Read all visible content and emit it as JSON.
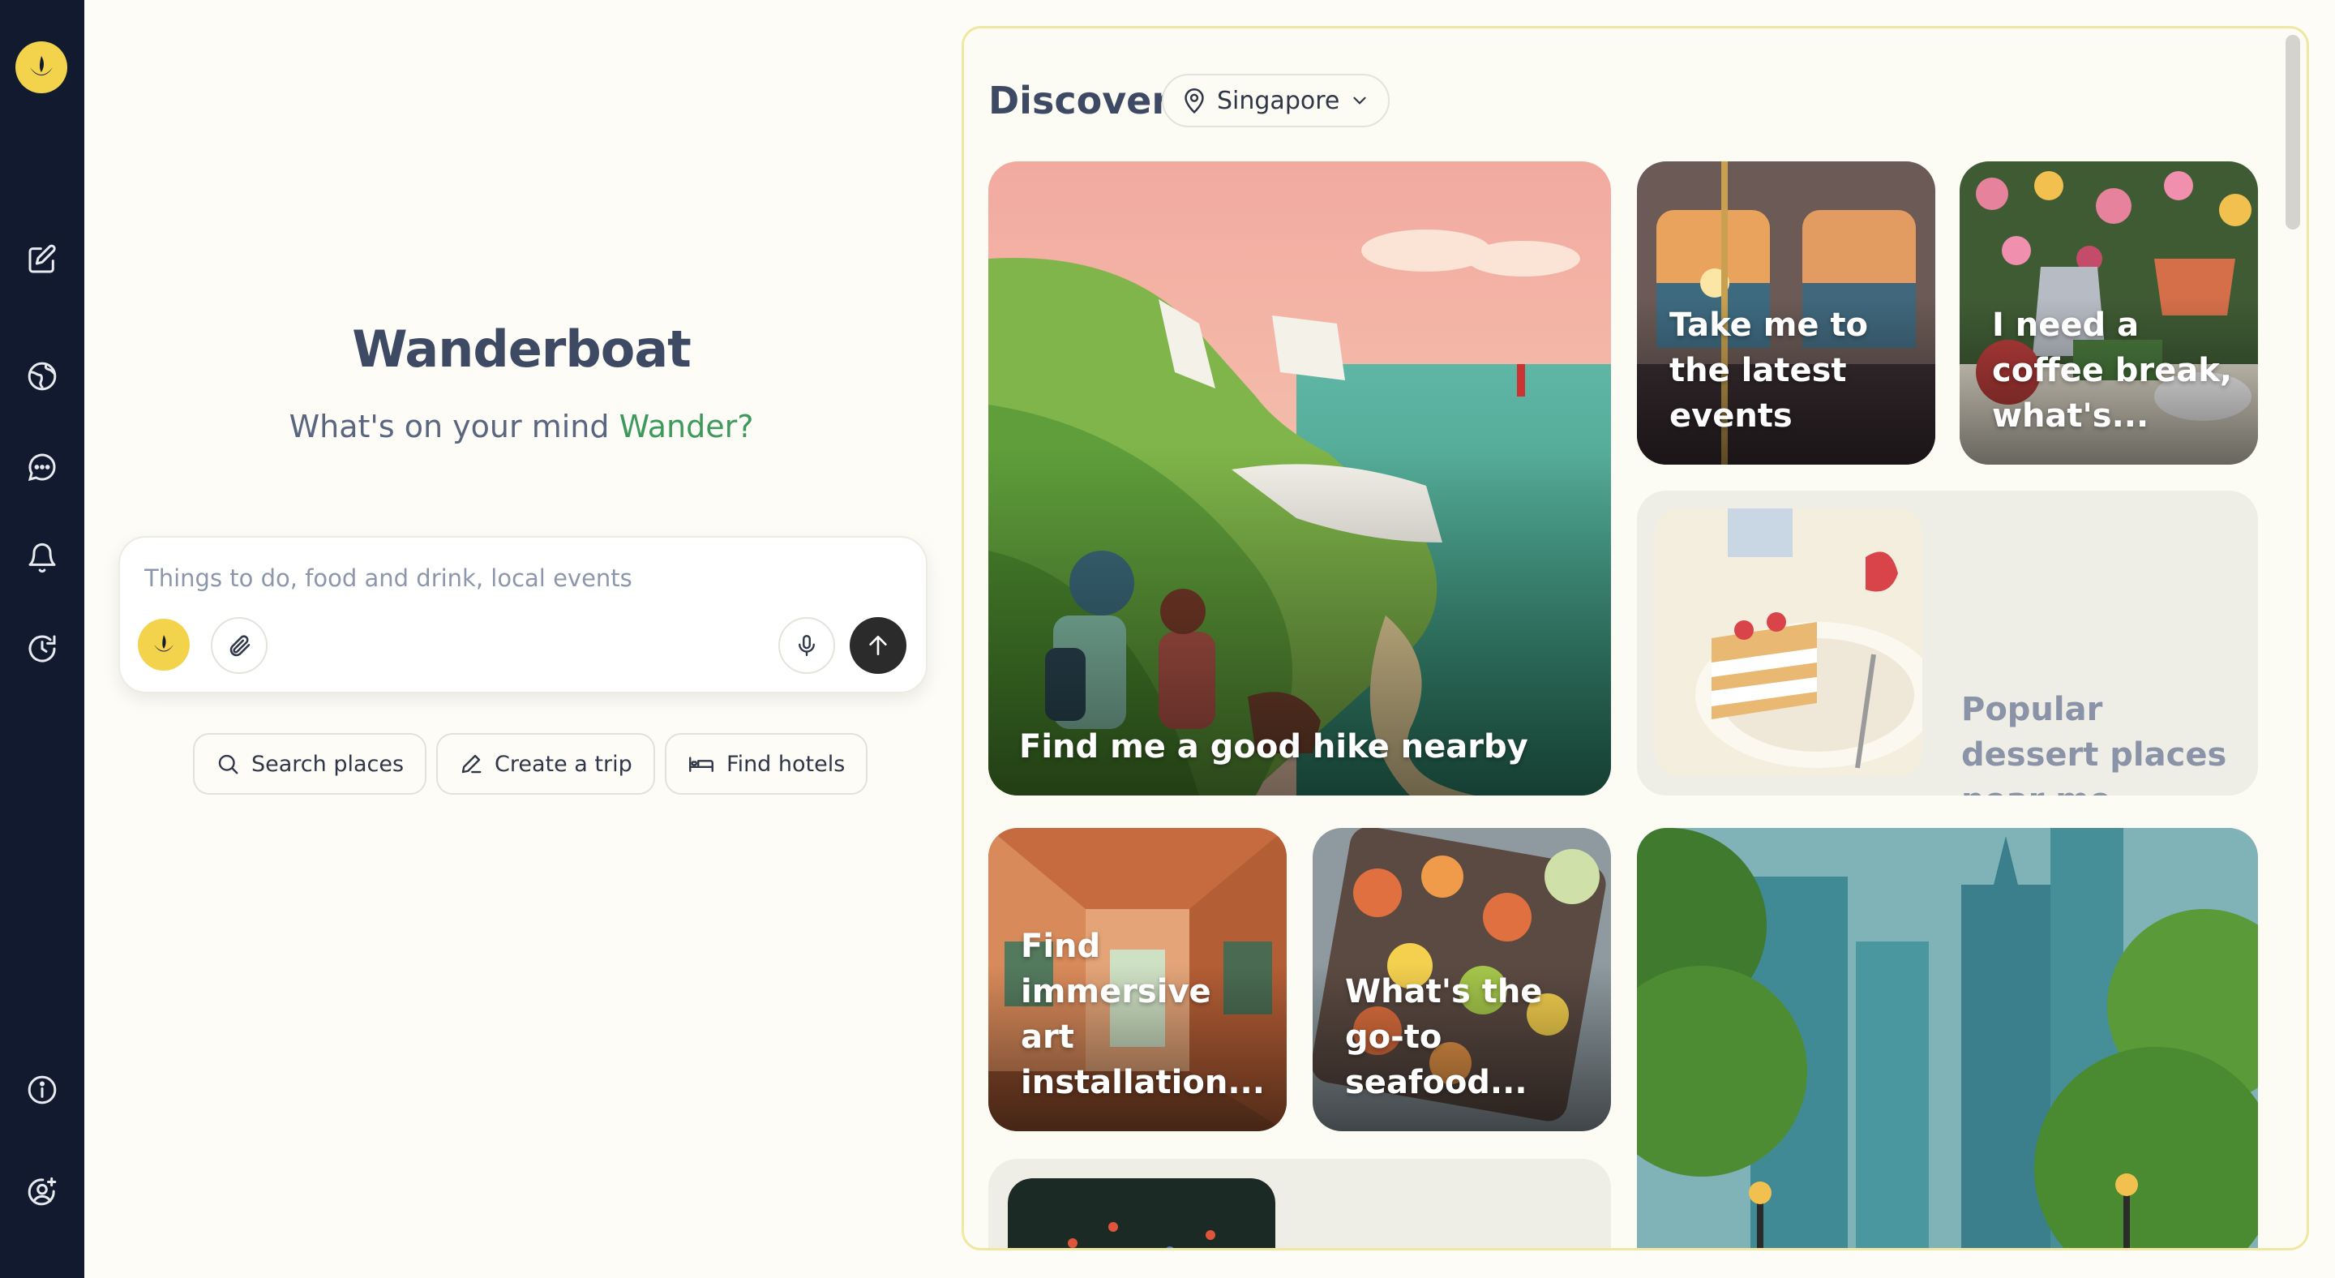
{
  "sidebar": {
    "items": [
      {
        "name": "new-chat",
        "icon": "edit-icon"
      },
      {
        "name": "explore",
        "icon": "globe-icon"
      },
      {
        "name": "chats",
        "icon": "chat-bubble-icon"
      },
      {
        "name": "notifications",
        "icon": "bell-icon"
      },
      {
        "name": "history",
        "icon": "history-icon"
      }
    ],
    "bottom": [
      {
        "name": "info",
        "icon": "info-icon"
      },
      {
        "name": "account",
        "icon": "user-add-icon"
      }
    ]
  },
  "main": {
    "title": "Wanderboat",
    "subtitle_prefix": "What's on your mind",
    "subtitle_name": "Wander?",
    "composer": {
      "placeholder": "Things to do, food and drink, local events"
    },
    "chips": [
      {
        "label": "Search places",
        "icon": "search-icon"
      },
      {
        "label": "Create a trip",
        "icon": "pencil-icon"
      },
      {
        "label": "Find hotels",
        "icon": "bed-icon"
      }
    ]
  },
  "discover": {
    "title": "Discover",
    "location": "Singapore",
    "cards": {
      "hike": "Find me a good hike nearby",
      "events": "Take me to the latest events",
      "coffee": "I need a coffee break, what's...",
      "dessert": "Popular dessert places near me",
      "art": "Find immersive art installation...",
      "seafood": "What's the go-to seafood..."
    }
  },
  "colors": {
    "sidebar": "#111a2e",
    "brand_yellow": "#f2d34b",
    "accent_green": "#3e9a5b",
    "background": "#fdfcf7"
  }
}
